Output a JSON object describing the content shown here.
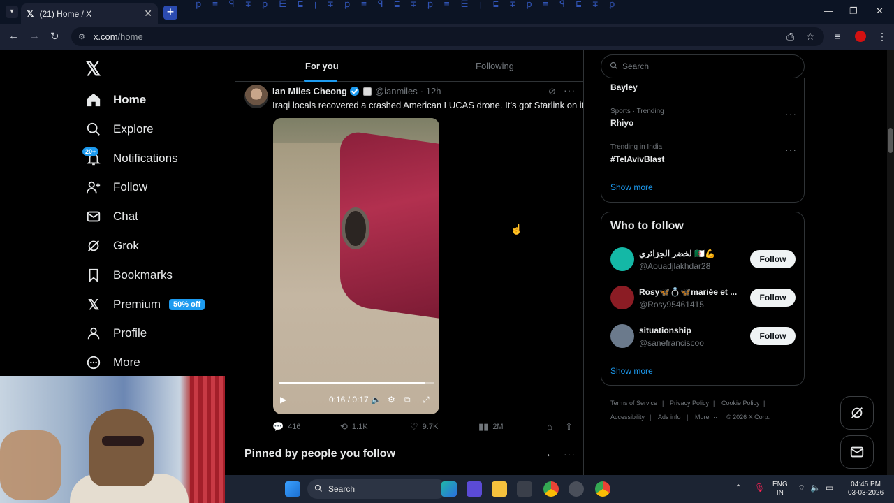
{
  "browser": {
    "tab_title": "(21) Home / X",
    "tab_close": "✕",
    "new_tab": "+",
    "url_host": "x.com",
    "url_path": "/home",
    "matrix_text": "ꝑ ≡ ꟼ ∓ ꝑ ⋿ ⊑ ꞁ ∓ ꝑ ≡ ꟼ ⊑ ∓ ꝑ ≡ ⋿ ꞁ ⊑ ∓ ꝑ ≡ ꟼ ⊑ ∓ ꝑ"
  },
  "sidebar": {
    "logo": "𝕏",
    "notifications_badge": "20+",
    "items": [
      {
        "label": "Home",
        "icon": "home-icon"
      },
      {
        "label": "Explore",
        "icon": "search-icon"
      },
      {
        "label": "Notifications",
        "icon": "bell-icon"
      },
      {
        "label": "Follow",
        "icon": "follow-icon"
      },
      {
        "label": "Chat",
        "icon": "mail-icon"
      },
      {
        "label": "Grok",
        "icon": "grok-icon"
      },
      {
        "label": "Bookmarks",
        "icon": "bookmark-icon"
      },
      {
        "label": "Premium",
        "icon": "x-icon"
      },
      {
        "label": "Profile",
        "icon": "profile-icon"
      },
      {
        "label": "More",
        "icon": "more-icon"
      }
    ],
    "premium_tag": "50% off"
  },
  "feed": {
    "tabs": [
      "For you",
      "Following"
    ],
    "tweet": {
      "name": "Ian Miles Cheong",
      "handle": "@ianmiles",
      "time": "· 12h",
      "text": "Iraqi locals recovered a crashed American LUCAS drone. It’s got Starlink on it.",
      "video_time": "0:16 / 0:17",
      "video_progress": 0.94,
      "replies": "416",
      "reposts": "1.1K",
      "likes": "9.7K",
      "views": "2M"
    },
    "pinned_title": "Pinned by people you follow"
  },
  "right": {
    "search_placeholder": "Search",
    "trends": [
      {
        "meta": "",
        "name": "Bayley"
      },
      {
        "meta": "Sports · Trending",
        "name": "Rhiyo"
      },
      {
        "meta": "Trending in India",
        "name": "#TelAvivBlast"
      }
    ],
    "show_more": "Show more",
    "who_to_follow": "Who to follow",
    "accounts": [
      {
        "name": "لخضر الجزائري 🇩🇿💪",
        "handle": "@Aouadjlakhdar28",
        "color": "#14b8a6"
      },
      {
        "name": "Rosy🦋💍🦋mariée et ...",
        "handle": "@Rosy95461415",
        "color": "#8b1c24"
      },
      {
        "name": "situationship",
        "handle": "@sanefranciscoo",
        "color": "#6b7a8c"
      }
    ],
    "follow_label": "Follow",
    "footer": [
      "Terms of Service",
      "|",
      "Privacy Policy",
      "|",
      "Cookie Policy",
      "|",
      "Accessibility",
      "|",
      "Ads info",
      "|",
      "More ···",
      "© 2026 X Corp."
    ]
  },
  "taskbar": {
    "search": "Search",
    "lang_top": "ENG",
    "lang_bottom": "IN",
    "time": "04:45 PM",
    "date": "03-03-2026"
  }
}
